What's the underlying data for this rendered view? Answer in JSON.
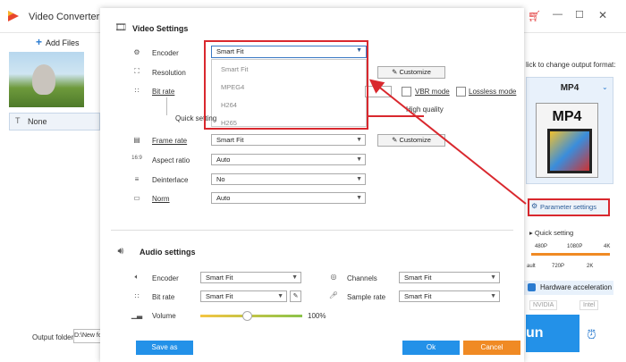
{
  "app": {
    "title": "Video Converter",
    "add_files": "Add Files",
    "file_item": "None",
    "output_folder_label": "Output folder:",
    "output_folder_value": "D:\\New fo"
  },
  "right_panel": {
    "hint": "lick to change output format:",
    "format": "MP4",
    "format_icon_text": "MP4",
    "parameter_settings": "Parameter settings",
    "quick_setting": "Quick setting",
    "ticks_top": [
      "480P",
      "1080P",
      "4K"
    ],
    "ticks_bottom": [
      "ault",
      "720P",
      "2K"
    ],
    "hardware_acceleration": "Hardware acceleration",
    "nvidia": "NVIDIA",
    "intel": "Intel",
    "run": "un"
  },
  "dialog": {
    "video_settings_title": "Video Settings",
    "encoder_label": "Encoder",
    "encoder_value": "Smart Fit",
    "encoder_options": [
      "Smart Fit",
      "MPEG4",
      "H264",
      "H265"
    ],
    "resolution_label": "Resolution",
    "customize_label": "Customize",
    "bitrate_label": "Bit rate",
    "vbr_label": "VBR mode",
    "lossless_label": "Lossless mode",
    "quick_setting_label": "Quick setting",
    "high_quality_label": "High quality",
    "framerate_label": "Frame rate",
    "framerate_value": "Smart Fit",
    "aspect_label": "Aspect ratio",
    "aspect_value": "Auto",
    "deinterlace_label": "Deinterlace",
    "deinterlace_value": "No",
    "norm_label": "Norm",
    "norm_value": "Auto",
    "audio_settings_title": "Audio settings",
    "audio_encoder_label": "Encoder",
    "audio_encoder_value": "Smart Fit",
    "channels_label": "Channels",
    "channels_value": "Smart Fit",
    "audio_bitrate_label": "Bit rate",
    "audio_bitrate_value": "Smart Fit",
    "sample_rate_label": "Sample rate",
    "sample_rate_value": "Smart Fit",
    "volume_label": "Volume",
    "volume_value": "100%",
    "volume_level": 0.45,
    "save_as": "Save as",
    "ok": "Ok",
    "cancel": "Cancel"
  },
  "colors": {
    "accent_blue": "#2391e8",
    "orange": "#f08a24",
    "highlight_red": "#d9282e"
  }
}
